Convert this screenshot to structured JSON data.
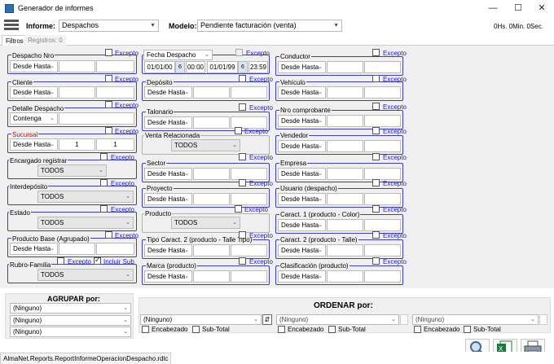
{
  "window": {
    "title": "Generador de informes",
    "min": "—",
    "max": "☐",
    "close": "✕"
  },
  "toolbar": {
    "informe_label": "Informe:",
    "informe_value": "Despachos",
    "modelo_label": "Modelo:",
    "modelo_value": "Pendiente facturación (venta)",
    "timer": "0Hs. 0Min. 0Sec."
  },
  "tabs": {
    "filtros": "Filtros",
    "registros": "Registros: 0"
  },
  "check_label": "Excepto",
  "filters": {
    "despacho_nro": {
      "label": "Despacho Nro",
      "mode": "Desde Hasta"
    },
    "fecha_despacho": {
      "label": "Fecha Despacho",
      "from_date": "01/01/00",
      "from_time": "00:00",
      "to_date": "01/01/99",
      "to_time": "23:59",
      "cal": "6"
    },
    "conductor": {
      "label": "Conductor",
      "mode": "Desde Hasta"
    },
    "cliente": {
      "label": "Cliente",
      "mode": "Desde Hasta"
    },
    "deposito": {
      "label": "Depósito",
      "mode": "Desde Hasta"
    },
    "vehiculo": {
      "label": "Vehículo",
      "mode": "Desde Hasta"
    },
    "detalle_despacho": {
      "label": "Detalle Despacho",
      "mode": "Contenga"
    },
    "talonario": {
      "label": "Talonario",
      "mode": "Desde Hasta"
    },
    "nro_comprobante": {
      "label": "Nro comprobante",
      "mode": "Desde Hasta"
    },
    "sucursal": {
      "label": "Sucursal",
      "mode": "Desde Hasta",
      "from": "1",
      "to": "1"
    },
    "venta_relacionada": {
      "label": "Venta Relacionada",
      "value": "TODOS"
    },
    "vendedor": {
      "label": "Vendedor",
      "mode": "Desde Hasta"
    },
    "encargado_registrar": {
      "label": "Encargado registrar",
      "value": "TODOS"
    },
    "sector": {
      "label": "Sector",
      "mode": "Desde Hasta"
    },
    "empresa": {
      "label": "Empresa",
      "mode": "Desde Hasta"
    },
    "interdeposito": {
      "label": "Interdepósito",
      "value": "TODOS"
    },
    "proyecto": {
      "label": "Proyecto",
      "mode": "Desde Hasta"
    },
    "usuario_despacho": {
      "label": "Usuario (despacho)",
      "mode": "Desde Hasta"
    },
    "estado": {
      "label": "Estado",
      "value": "TODOS"
    },
    "producto": {
      "label": "Producto",
      "value": "TODOS"
    },
    "caract1": {
      "label": "Caract. 1 (producto - Color)",
      "mode": "Desde Hasta"
    },
    "producto_base": {
      "label": "Producto Base (Agrupado)",
      "mode": "Desde Hasta"
    },
    "tipo_caract2": {
      "label": "Tipo Caract. 2 (producto - Talle Tipo)",
      "mode": "Desde Hasta"
    },
    "caract2": {
      "label": "Caract. 2 (producto - Talle)",
      "mode": "Desde Hasta"
    },
    "rubro_familia": {
      "label": "Rubro-Familia",
      "value": "TODOS",
      "incluir_sub": "Incluir Sub"
    },
    "marca": {
      "label": "Marca (producto)",
      "mode": "Desde Hasta"
    },
    "clasificacion": {
      "label": "Clasificación (producto)",
      "mode": "Desde Hasta"
    }
  },
  "agrupar": {
    "title": "AGRUPAR por:",
    "items": [
      "(Ninguno)",
      "(Ninguno)",
      "(Ninguno)"
    ]
  },
  "ordenar": {
    "title": "ORDENAR  por:",
    "items": [
      "(Ninguno)",
      "(Ninguno)",
      "(Ninguno)"
    ],
    "encabezado": "Encabezado",
    "subtotal": "Sub-Total"
  },
  "status": {
    "report_file": "AlmaNet.Reports.ReportInformeOperacionDespacho.rdlc"
  }
}
